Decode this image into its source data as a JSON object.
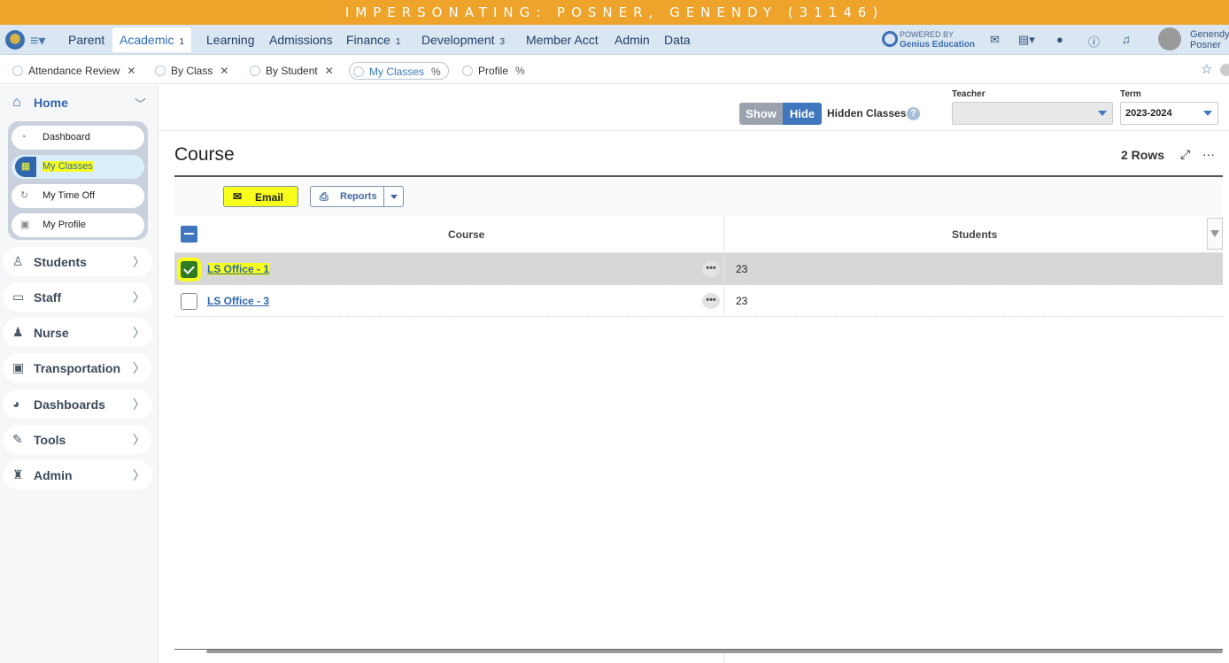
{
  "banner": {
    "text": "IMPERSONATING: POSNER, GENENDY (31146)"
  },
  "topnav": {
    "items": [
      {
        "label": "Parent",
        "badge": ""
      },
      {
        "label": "Academic",
        "badge": "1"
      },
      {
        "label": "Learning",
        "badge": ""
      },
      {
        "label": "Admissions",
        "badge": ""
      },
      {
        "label": "Finance",
        "badge": "1"
      },
      {
        "label": "Development",
        "badge": "3"
      },
      {
        "label": "Member Acct",
        "badge": ""
      },
      {
        "label": "Admin",
        "badge": ""
      },
      {
        "label": "Data",
        "badge": ""
      }
    ],
    "powered_by": "POWERED BY",
    "powered_brand": "Genius Education",
    "user_first": "Genendy",
    "user_last": "Posner"
  },
  "tabs": [
    {
      "label": "Attendance Review",
      "close": "✕"
    },
    {
      "label": "By Class",
      "close": "✕"
    },
    {
      "label": "By Student",
      "close": "✕"
    },
    {
      "label": "My Classes",
      "close": "%"
    },
    {
      "label": "Profile",
      "close": "%"
    }
  ],
  "sidebar": {
    "home": "Home",
    "home_items": [
      {
        "label": "Dashboard",
        "icon": "dashboard-icon"
      },
      {
        "label": "My Classes",
        "icon": "classes-icon"
      },
      {
        "label": "My Time Off",
        "icon": "time-off-icon"
      },
      {
        "label": "My Profile",
        "icon": "profile-icon"
      }
    ],
    "sections": [
      {
        "label": "Students",
        "icon": "students-icon"
      },
      {
        "label": "Staff",
        "icon": "staff-icon"
      },
      {
        "label": "Nurse",
        "icon": "nurse-icon"
      },
      {
        "label": "Transportation",
        "icon": "bus-icon"
      },
      {
        "label": "Dashboards",
        "icon": "dashboards-icon"
      },
      {
        "label": "Tools",
        "icon": "wrench-icon"
      },
      {
        "label": "Admin",
        "icon": "admin-icon"
      }
    ]
  },
  "filters": {
    "show_label": "Show",
    "hide_label": "Hide",
    "hidden_classes_label": "Hidden Classes",
    "help": "?",
    "teacher_label": "Teacher",
    "teacher_value": "",
    "term_label": "Term",
    "term_value": "2023-2024"
  },
  "main": {
    "title": "Course",
    "rows_count": "2 Rows",
    "email_label": "Email",
    "reports_label": "Reports",
    "columns": {
      "course": "Course",
      "students": "Students"
    },
    "rows": [
      {
        "course": "LS Office - 1",
        "students": "23",
        "checked": true
      },
      {
        "course": "LS Office - 3",
        "students": "23",
        "checked": false
      }
    ]
  },
  "colors": {
    "banner": "#eea32a",
    "accent": "#3f76bd",
    "highlight": "#f8ff1c"
  }
}
